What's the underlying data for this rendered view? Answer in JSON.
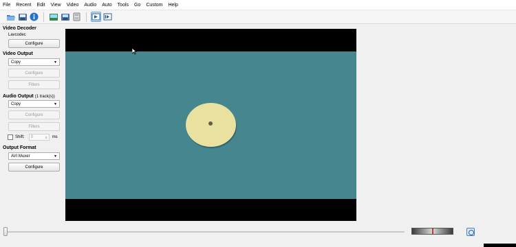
{
  "menu": [
    "File",
    "Recent",
    "Edit",
    "View",
    "Video",
    "Audio",
    "Auto",
    "Tools",
    "Go",
    "Custom",
    "Help"
  ],
  "toolbar": {
    "icons": [
      "open-folder-icon",
      "save-icon",
      "info-icon",
      "open-image-icon",
      "save-image-icon",
      "calculator-icon",
      "play-filtered-icon",
      "play-output-icon"
    ]
  },
  "video_decoder": {
    "title": "Video Decoder",
    "codec": "Lavcodec",
    "configure": "Configure"
  },
  "video_output": {
    "title": "Video Output",
    "selected": "Copy",
    "configure": "Configure",
    "filters": "Filters"
  },
  "audio_output": {
    "title": "Audio Output",
    "tracks": "(1 track(s))",
    "selected": "Copy",
    "configure": "Configure",
    "filters": "Filters",
    "shift_label": "Shift:",
    "shift_value": "0",
    "shift_unit": "ms"
  },
  "output_format": {
    "title": "Output Format",
    "selected": "AVI Muxer",
    "configure": "Configure"
  },
  "colors": {
    "frame": "#45868f",
    "disc": "#e8e1a0",
    "accent": "#6aa3d6"
  }
}
